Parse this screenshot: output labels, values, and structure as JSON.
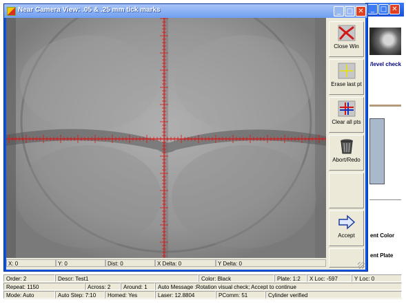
{
  "window": {
    "title": "Near Camera View: .05 & .25 mm tick marks",
    "minimize": "_",
    "maximize": "□",
    "close": "✕"
  },
  "tools": [
    {
      "label": "Close Win",
      "icon": "red-x-icon"
    },
    {
      "label": "Erase last pt",
      "icon": "yellow-crosshair-icon"
    },
    {
      "label": "Clear all pts",
      "icon": "blue-red-crosshair-icon"
    },
    {
      "label": "Abort/Redo",
      "icon": "trash-bin-icon"
    },
    {
      "label": "",
      "icon": ""
    },
    {
      "label": "Accept",
      "icon": "right-arrow-icon"
    }
  ],
  "coords": {
    "x": "X: 0",
    "y": "Y: 0",
    "dist": "Dist: 0",
    "xdelta": "X Delta: 0",
    "ydelta": "Y Delta: 0"
  },
  "background": {
    "level_check": "/level check",
    "ent_color": "ent Color",
    "ent_plate": "ent Plate",
    "min": "_",
    "max": "□",
    "close": "✕"
  },
  "status": {
    "order": "Order: 2",
    "descr": "Descr: Test1",
    "color": "Color: Black",
    "plate": "Plate: 1:2",
    "xloc": "X Loc: -597",
    "yloc": "Y Loc: 0",
    "repeat": "Repeat: 1150",
    "across": "Across: 2",
    "around": "Around: 1",
    "auto_message": "Auto Message :Rotation visual check; Accept to continue",
    "mode": "Mode: Auto",
    "auto_step": "Auto Step: 7:10",
    "homed": "Homed: Yes",
    "laser": "Laser: 12.8804",
    "pcomm": "PComm:  51",
    "cylinder": "Cylinder verified"
  },
  "colors": {
    "reticle": "#e01010",
    "title_blue": "#0a53e0",
    "panel": "#ece9d8"
  }
}
